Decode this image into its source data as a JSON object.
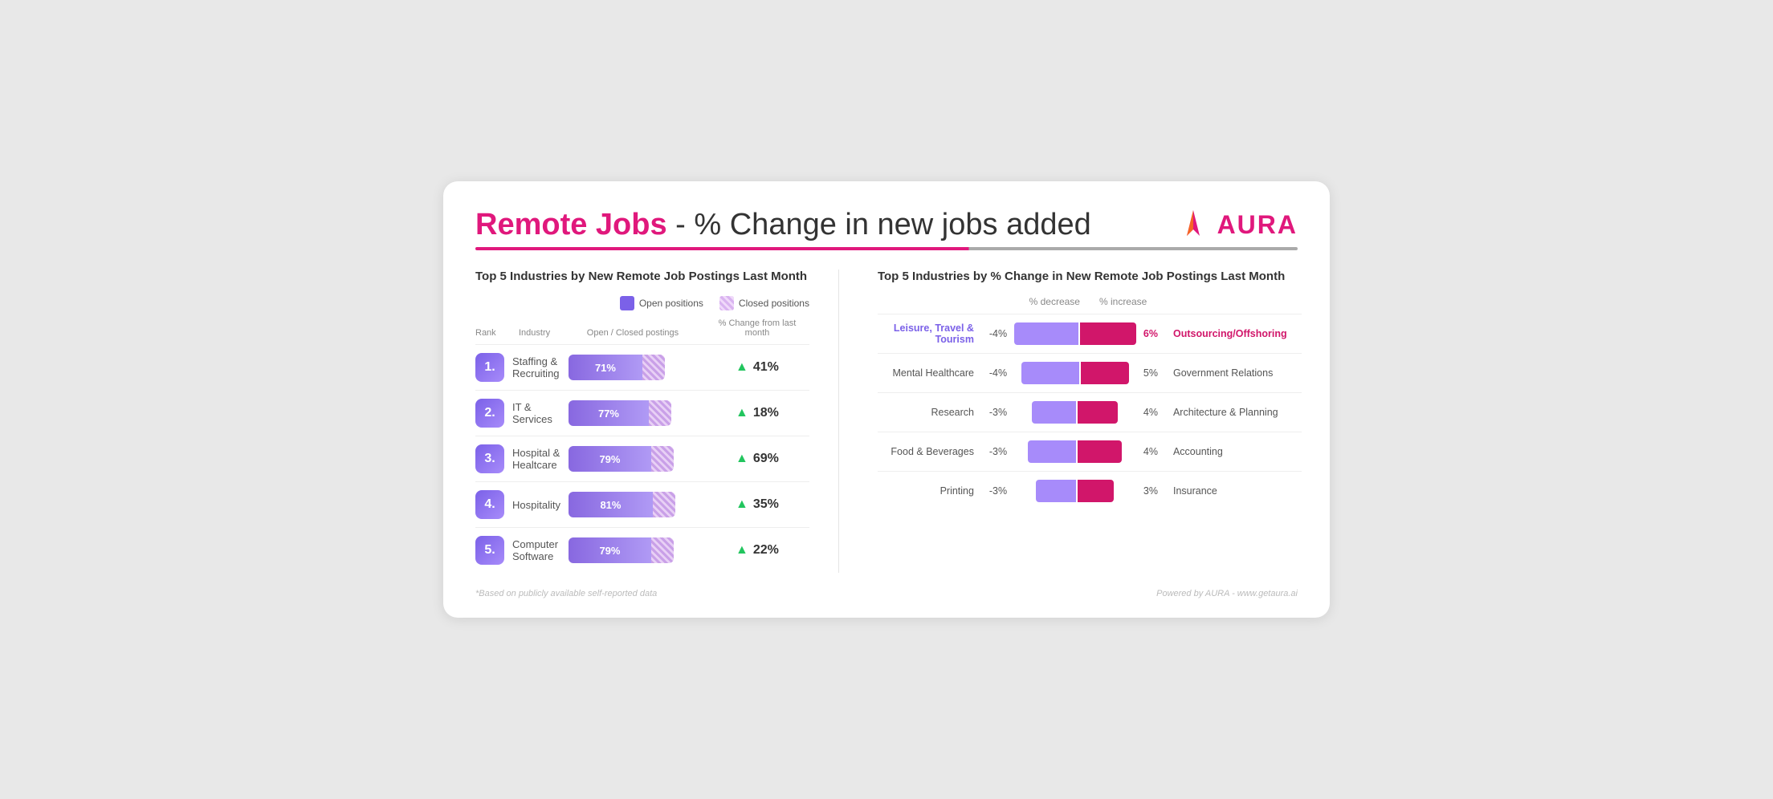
{
  "header": {
    "title_bold": "Remote Jobs",
    "title_rest": " - % Change in new jobs added"
  },
  "logo": {
    "text": "AURA"
  },
  "left_section": {
    "title": "Top 5 Industries by New Remote Job Postings Last Month",
    "legend": {
      "open_label": "Open positions",
      "closed_label": "Closed positions"
    },
    "table_headers": {
      "rank": "Rank",
      "industry": "Industry",
      "postings": "Open / Closed postings",
      "change": "% Change from last month"
    },
    "rows": [
      {
        "rank": "1.",
        "industry": "Staffing & Recruiting",
        "open_pct": 71,
        "open_label": "71%",
        "change": "41%"
      },
      {
        "rank": "2.",
        "industry": "IT & Services",
        "open_pct": 77,
        "open_label": "77%",
        "change": "18%"
      },
      {
        "rank": "3.",
        "industry": "Hospital & Healtcare",
        "open_pct": 79,
        "open_label": "79%",
        "change": "69%"
      },
      {
        "rank": "4.",
        "industry": "Hospitality",
        "open_pct": 81,
        "open_label": "81%",
        "change": "35%"
      },
      {
        "rank": "5.",
        "industry": "Computer Software",
        "open_pct": 79,
        "open_label": "79%",
        "change": "22%"
      }
    ]
  },
  "right_section": {
    "title": "Top 5 Industries by % Change in New Remote Job Postings Last Month",
    "decrease_label": "% decrease",
    "increase_label": "% increase",
    "rows": [
      {
        "left_industry": "Leisure, Travel & Tourism",
        "left_highlight": true,
        "dec_pct": "-4%",
        "bar_left_width": 80,
        "bar_right_width": 70,
        "inc_pct": "6%",
        "inc_highlight": true,
        "right_industry": "Outsourcing/Offshoring",
        "right_highlight": true
      },
      {
        "left_industry": "Mental Healthcare",
        "left_highlight": false,
        "dec_pct": "-4%",
        "bar_left_width": 72,
        "bar_right_width": 60,
        "inc_pct": "5%",
        "inc_highlight": false,
        "right_industry": "Government Relations",
        "right_highlight": false
      },
      {
        "left_industry": "Research",
        "left_highlight": false,
        "dec_pct": "-3%",
        "bar_left_width": 55,
        "bar_right_width": 50,
        "inc_pct": "4%",
        "inc_highlight": false,
        "right_industry": "Architecture & Planning",
        "right_highlight": false
      },
      {
        "left_industry": "Food & Beverages",
        "left_highlight": false,
        "dec_pct": "-3%",
        "bar_left_width": 60,
        "bar_right_width": 55,
        "inc_pct": "4%",
        "inc_highlight": false,
        "right_industry": "Accounting",
        "right_highlight": false
      },
      {
        "left_industry": "Printing",
        "left_highlight": false,
        "dec_pct": "-3%",
        "bar_left_width": 50,
        "bar_right_width": 45,
        "inc_pct": "3%",
        "inc_highlight": false,
        "right_industry": "Insurance",
        "right_highlight": false
      }
    ]
  },
  "footer": {
    "note": "*Based on publicly available self-reported data",
    "powered": "Powered by AURA - www.getaura.ai"
  }
}
